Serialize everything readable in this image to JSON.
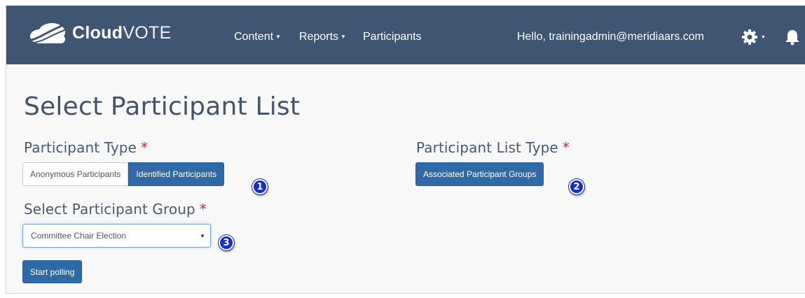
{
  "app": {
    "brand_bold": "Cloud",
    "brand_light": "VOTE"
  },
  "nav": {
    "items": [
      {
        "label": "Content",
        "has_caret": true
      },
      {
        "label": "Reports",
        "has_caret": true
      },
      {
        "label": "Participants",
        "has_caret": false
      }
    ],
    "greeting": "Hello, trainingadmin@meridiaars.com",
    "settings_icon": "gear-icon",
    "notifications_icon": "bell-icon"
  },
  "page": {
    "title": "Select Participant List"
  },
  "participant_type": {
    "label": "Participant Type",
    "required_mark": "*",
    "options": [
      "Anonymous Participants",
      "Identified Participants"
    ],
    "selected": "Identified Participants"
  },
  "participant_list_type": {
    "label": "Participant List Type",
    "required_mark": "*",
    "button": "Associated Participant Groups"
  },
  "participant_group": {
    "label": "Select Participant Group",
    "required_mark": "*",
    "selected_value": "Committee Chair Election"
  },
  "actions": {
    "start": "Start polling"
  },
  "callouts": [
    "1",
    "2",
    "3"
  ],
  "colors": {
    "navbar": "#3f5572",
    "primary": "#2f6aa7",
    "required": "#c9302c",
    "callout": "#1431c4"
  }
}
